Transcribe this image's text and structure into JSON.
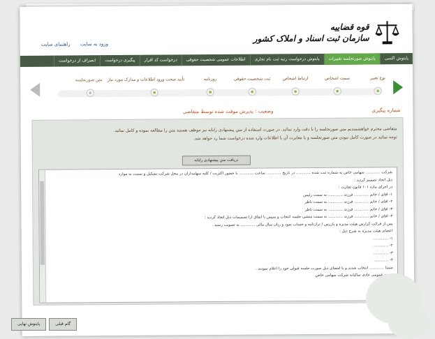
{
  "header": {
    "org_title_line1": "قوه قضاییه",
    "org_title_line2": "سازمان ثبت اسناد و املاک کشور",
    "links": [
      "ورود به سایت",
      "راهنمای سایت"
    ]
  },
  "nav": {
    "items": [
      "پایتوش اکسی",
      "پایتوش صورتجلسه تغییرات",
      "پایتوش درخواست رتبه ثبت نام تجاری",
      "اطلاعات عمومی شخصیت حقوقی",
      "درخواست کد اقرار",
      "پیگیری درخواست",
      "انصراف از درخواست"
    ]
  },
  "steps": {
    "labels": [
      "نوع تغییر",
      "سمت اشخاص",
      "ارتباط اشخاص",
      "ثبت شخصیت حقوقی",
      "روزنامه",
      "تأیید صحت ورود اطلاعات و مدارک مورد نیاز",
      "متن صورتجلسه"
    ]
  },
  "tracking_label": "شماره پیگیری",
  "status_text": "وضعیت : پذیرش موقت شده توسط متقاضی",
  "notice": {
    "line1": "متقاضی محترم خواهشمندیم متن صورتجلسه را با دقت وارد نمائید. در صورت استفاده از متن پیشنهادی رایانه نیز موظف هستید متن را مطالعه نموده و کامل نمائید.",
    "line2": "توجه نمائید در صورت کامل نبودن متن صورتجلسه و یا مغایرت آن با اطلاعات وارد شده درخواست شما رد خواهد شد."
  },
  "download_button": "دریافت متن پیشنهادی رایانه",
  "document": {
    "lines": [
      "شرکت ............ سهامی خاص به شماره ثبت شده ............ در تاریخ ............ ساعت ............ با حضور اکثریت / کلیه سهامداران در محل شرکت تشکیل و نسبت به موارد",
      "ذیل اتخاذ تصمیم گردید :",
      "در اجرای ماده ۱۰۱ قانون تجارت :",
      "۱- آقای / خانم ............ فرزند ............ به سمت رئیس",
      "۲- آقای / خانم ............ فرزند ............ به سمت ناظر",
      "۳- آقای / خانم ............ فرزند ............ به سمت ناظر",
      "۴- آقای / خانم ............ فرزند ............ به سمت منشی جلسه انتخاب و سپس با اتفاق آرا تصمیمات ذیل اتخاذ گردید :",
      "پس از قرائت گزارش هیئت مدیره و بازرس / ترازنامه و حساب سود و زیان سال مالی ............ به تصویب رسید .",
      "اعضای هیئت مدیره به شرح ذیل :",
      "۱- ............",
      "۲- ............",
      "۳- ............",
      "۴- ............",
      "ضمنا ............ انتخاب شدند و با امضای ذیل صورت جلسه قبولی خود را اعلام نمودند .",
      "مجمع عمومی عادی سالیانه شرکت سهامی خاص"
    ]
  },
  "footer": {
    "prev_button": "گام قبلی",
    "final_button": "پایتوش نهایی"
  },
  "colors": {
    "nav_bg": "#475a44",
    "nav_active": "#63a94c",
    "status_text": "#b04a1a"
  }
}
